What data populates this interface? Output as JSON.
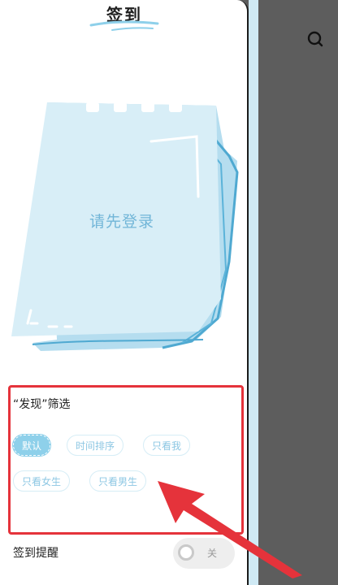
{
  "header": {
    "title": "签到"
  },
  "illustration": {
    "login_prompt": "请先登录"
  },
  "filter": {
    "label": "“发现”筛选",
    "options": [
      {
        "label": "默认",
        "selected": true
      },
      {
        "label": "时间排序",
        "selected": false
      },
      {
        "label": "只看我",
        "selected": false
      },
      {
        "label": "只看女生",
        "selected": false
      },
      {
        "label": "只看男生",
        "selected": false
      }
    ]
  },
  "reminder": {
    "label": "签到提醒",
    "toggle_state": "关"
  },
  "icons": {
    "search": "search-icon"
  },
  "colors": {
    "accent": "#8ed0ea",
    "chip_text": "#8dc7e3",
    "notepad_fill": "#d8eef7",
    "highlight": "#e5333b"
  }
}
